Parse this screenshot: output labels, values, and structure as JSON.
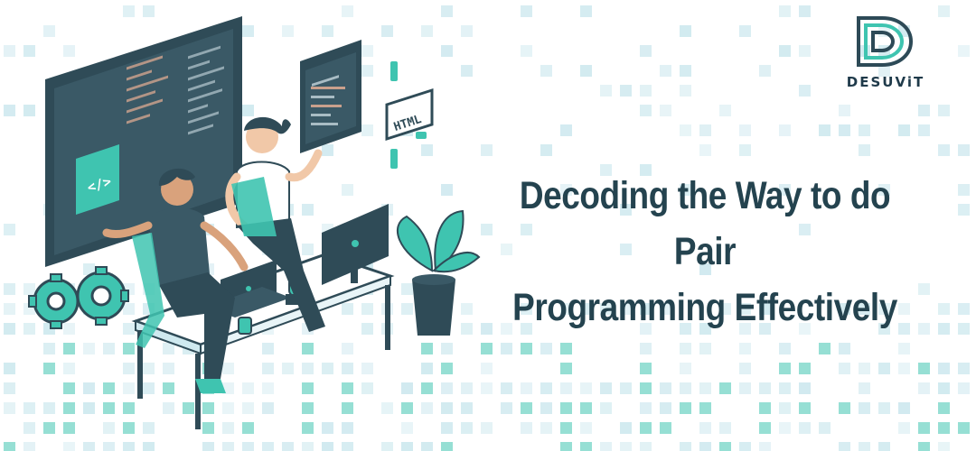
{
  "brand": {
    "name": "DESUViT",
    "logo_icon": "desuvit-d-logo-icon",
    "colors": {
      "primary": "#2d4a57",
      "accent": "#3fc4b0",
      "light": "#cfe9ef"
    }
  },
  "headline": {
    "line1": "Decoding the Way to do Pair",
    "line2": "Programming Effectively"
  },
  "illustration": {
    "code_badge": "</>",
    "html_tag": "HTML"
  }
}
